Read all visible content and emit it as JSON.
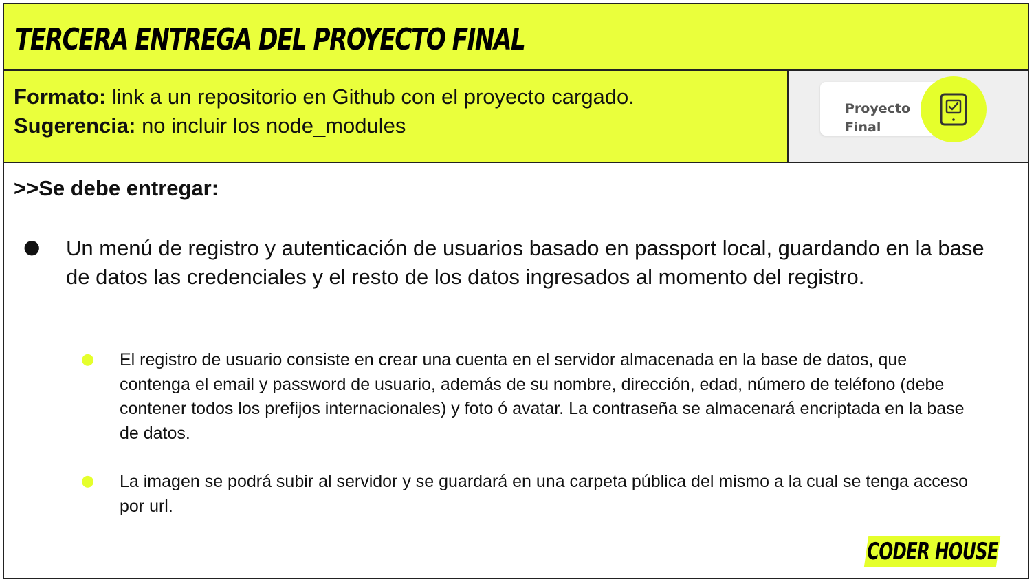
{
  "header": {
    "title": "TERCERA ENTREGA DEL PROYECTO FINAL"
  },
  "format": {
    "format_label": "Formato:",
    "format_text": " link a un repositorio en Github con el proyecto cargado.",
    "suggestion_label": "Sugerencia:",
    "suggestion_text": " no incluir los node_modules"
  },
  "badge": {
    "line1": "Proyecto",
    "line2": "Final",
    "icon": "checklist-tablet-icon",
    "accent": "#e5ff2c"
  },
  "content": {
    "heading": ">>Se debe entregar:",
    "main_bullet": "Un menú de registro y autenticación de usuarios basado en passport local, guardando en la base de datos las credenciales y el resto de los datos ingresados al momento del registro.",
    "sub_items": [
      "El registro de usuario consiste en crear una cuenta en el servidor almacenada en la base de datos, que contenga el email y password de usuario, además de su nombre, dirección, edad, número de teléfono (debe contener todos los prefijos internacionales) y foto ó avatar. La contraseña se almacenará encriptada en la base de datos.",
      "La imagen se podrá subir al servidor y se guardará en una carpeta pública del mismo a la cual se tenga acceso por url."
    ]
  },
  "footer": {
    "logo": "CODER HOUSE"
  }
}
